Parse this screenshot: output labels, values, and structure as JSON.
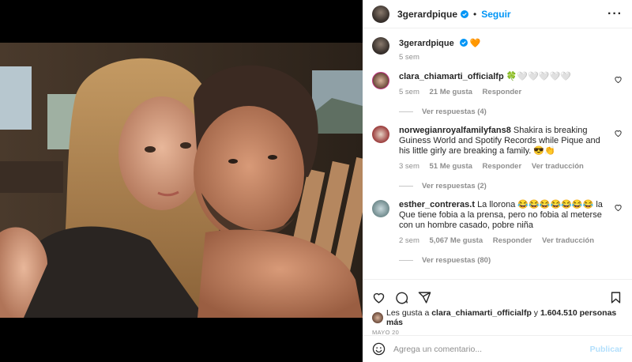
{
  "header": {
    "username": "3gerardpique",
    "separator": "•",
    "follow_label": "Seguir",
    "more_label": "···"
  },
  "caption": {
    "username": "3gerardpique",
    "emoji": "🧡",
    "time": "5 sem"
  },
  "comments": [
    {
      "username": "clara_chiamarti_officialfp",
      "text": "🍀🤍🤍🤍🤍🤍",
      "time": "5 sem",
      "likes": "21 Me gusta",
      "reply": "Responder",
      "translate": "",
      "view_replies": "Ver respuestas (4)"
    },
    {
      "username": "norwegianroyalfamilyfans8",
      "text": "Shakira is breaking Guiness World and Spotify Records while Pique and his little girly are breaking a family. 😎👏",
      "time": "3 sem",
      "likes": "51 Me gusta",
      "reply": "Responder",
      "translate": "Ver traducción",
      "view_replies": "Ver respuestas (2)"
    },
    {
      "username": "esther_contreras.t",
      "text": "La llorona 😂😂😂😂😂😂😂 la Que tiene fobia a la prensa, pero no fobia al meterse con un hombre casado, pobre niña",
      "time": "2 sem",
      "likes": "5,067 Me gusta",
      "reply": "Responder",
      "translate": "Ver traducción",
      "view_replies": "Ver respuestas (80)"
    }
  ],
  "likes": {
    "prefix": "Les gusta a",
    "user": "clara_chiamarti_officialfp",
    "joiner": "y",
    "others": "1.604.510 personas más"
  },
  "date": "MAYO 20",
  "add_comment": {
    "placeholder": "Agrega un comentario...",
    "post_label": "Publicar"
  },
  "colors": {
    "accent": "#0095f6",
    "muted": "#8e8e8e",
    "post_disabled": "#b2dffc"
  }
}
